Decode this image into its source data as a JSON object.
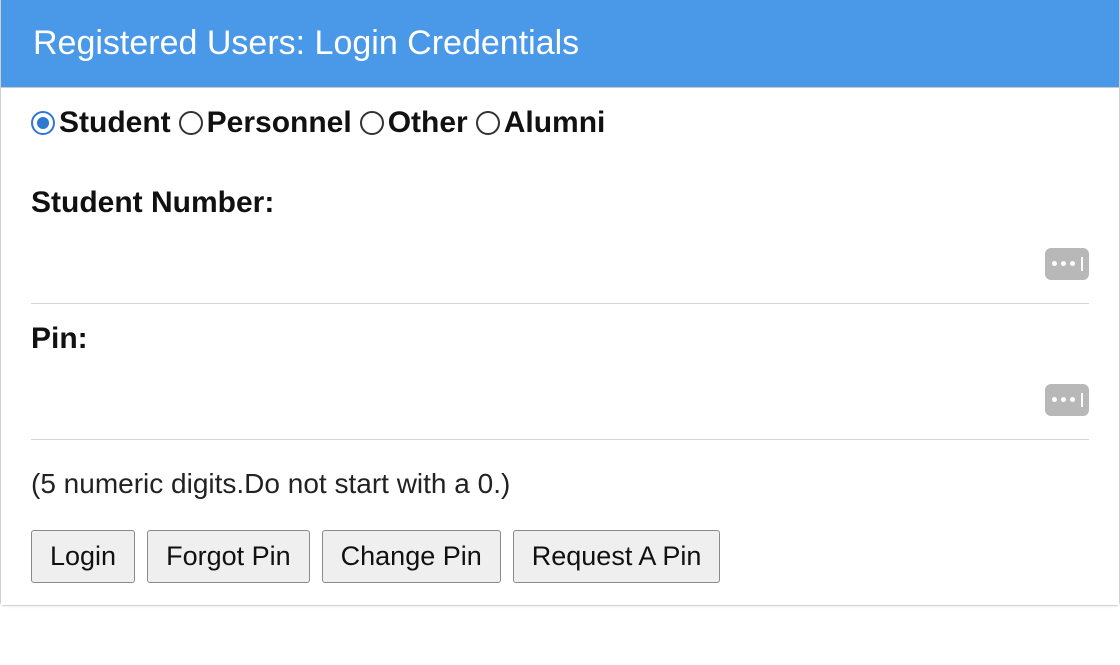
{
  "header": {
    "title": "Registered Users: Login Credentials"
  },
  "userTypes": {
    "options": [
      {
        "label": "Student",
        "selected": true
      },
      {
        "label": "Personnel",
        "selected": false
      },
      {
        "label": "Other",
        "selected": false
      },
      {
        "label": "Alumni",
        "selected": false
      }
    ]
  },
  "fields": {
    "studentNumber": {
      "label": "Student Number:",
      "value": ""
    },
    "pin": {
      "label": "Pin:",
      "value": ""
    }
  },
  "hint": "(5 numeric digits.Do not start with a 0.)",
  "buttons": {
    "login": "Login",
    "forgotPin": "Forgot Pin",
    "changePin": "Change Pin",
    "requestPin": "Request A Pin"
  }
}
